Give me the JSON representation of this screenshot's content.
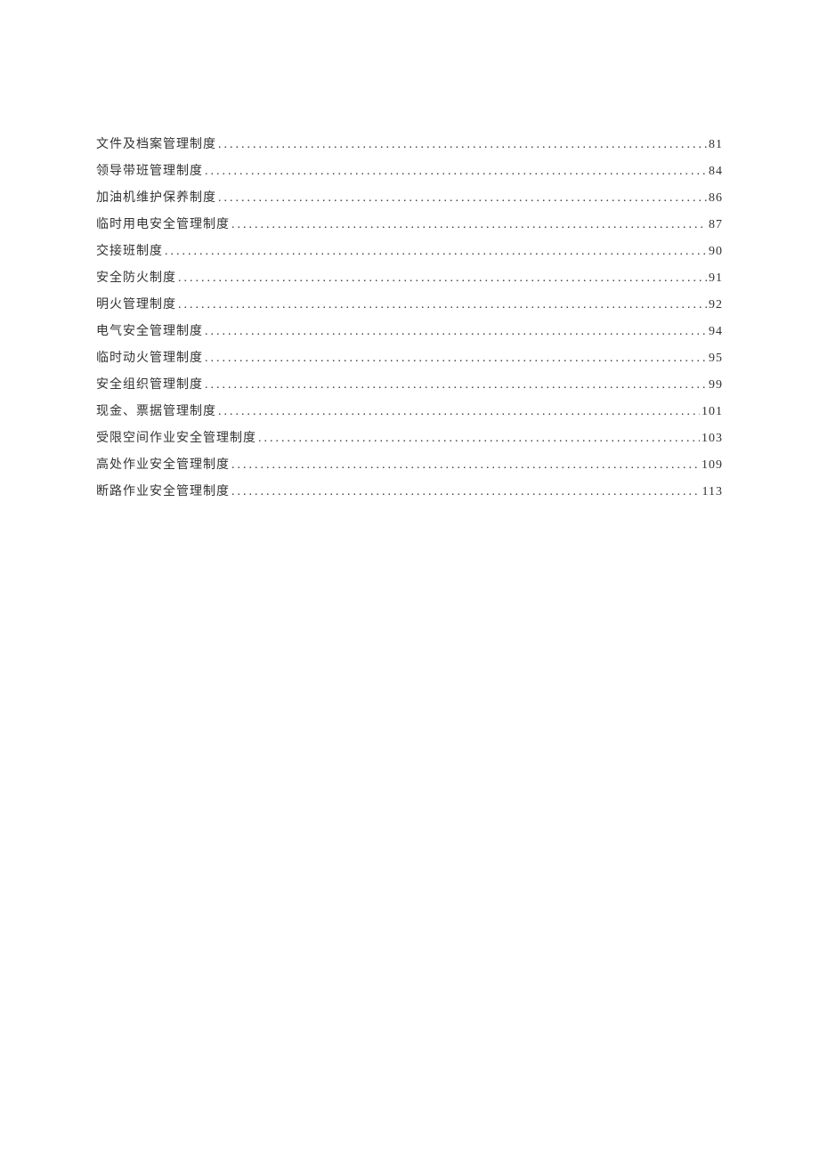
{
  "toc": {
    "entries": [
      {
        "title": "文件及档案管理制度",
        "page": "81"
      },
      {
        "title": "领导带班管理制度",
        "page": "84"
      },
      {
        "title": "加油机维护保养制度",
        "page": "86"
      },
      {
        "title": "临时用电安全管理制度",
        "page": "87"
      },
      {
        "title": "交接班制度",
        "page": "90"
      },
      {
        "title": "安全防火制度",
        "page": "91"
      },
      {
        "title": "明火管理制度",
        "page": "92"
      },
      {
        "title": "电气安全管理制度",
        "page": "94"
      },
      {
        "title": "临时动火管理制度",
        "page": "95"
      },
      {
        "title": "安全组织管理制度",
        "page": "99"
      },
      {
        "title": "现金、票据管理制度",
        "page": "101"
      },
      {
        "title": "受限空间作业安全管理制度",
        "page": "103"
      },
      {
        "title": "高处作业安全管理制度",
        "page": "109"
      },
      {
        "title": "断路作业安全管理制度",
        "page": "113"
      }
    ]
  }
}
